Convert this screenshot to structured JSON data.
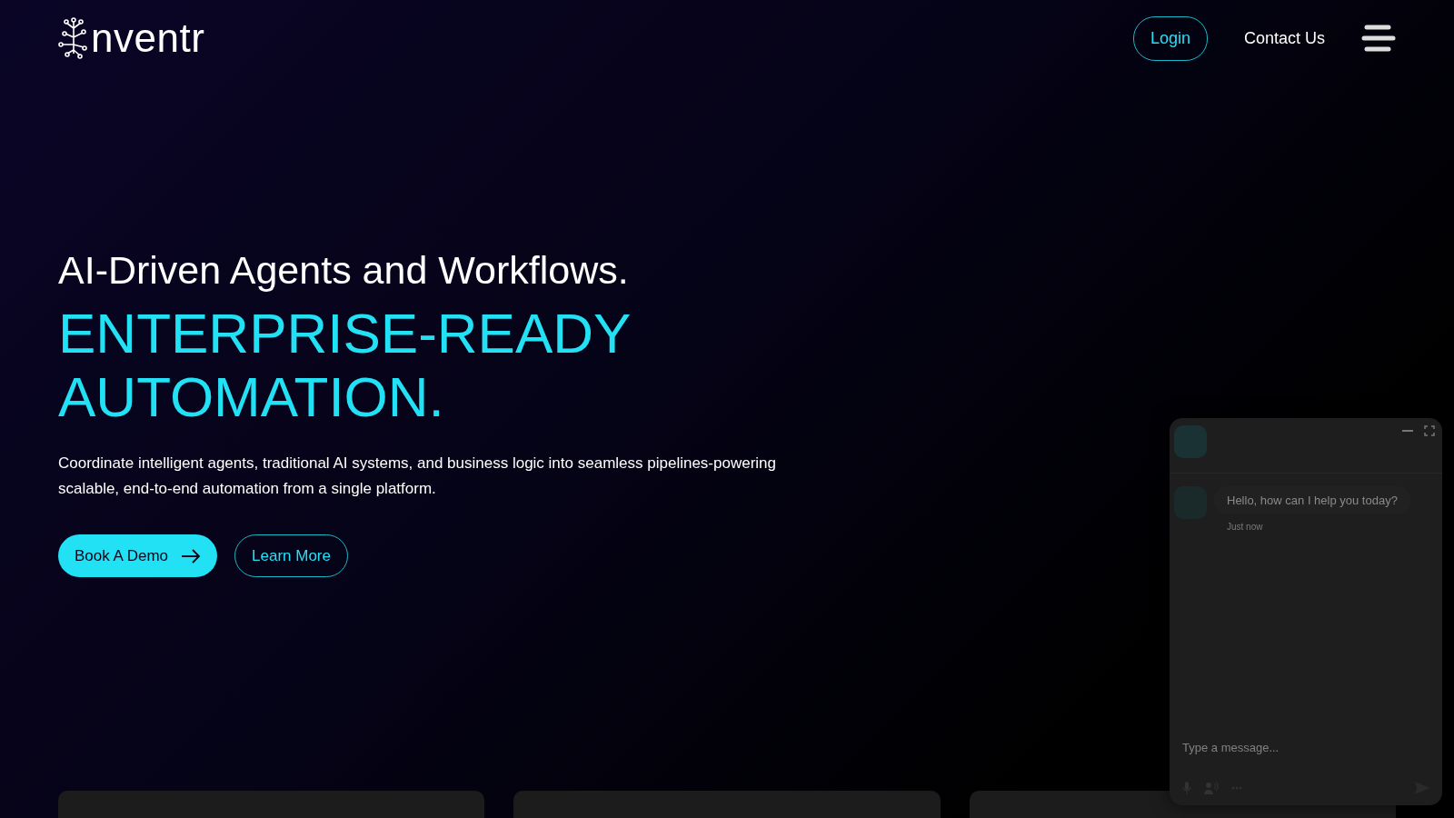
{
  "header": {
    "logo": "nventr",
    "nav": [
      {
        "kind": "outline",
        "label": "Login"
      },
      {
        "kind": "plain",
        "label": "Contact Us"
      }
    ]
  },
  "hero": {
    "subtitle": "AI-Driven Agents and Workflows.",
    "title_lines": [
      "ENTERPRISE-READY",
      "AUTOMATION."
    ],
    "description": "Coordinate intelligent agents, traditional AI systems, and business logic into seamless pipelines-powering scalable, end-to-end automation from a single platform.",
    "buttons": [
      {
        "kind": "primary",
        "label": "Book A Demo"
      },
      {
        "kind": "outline",
        "label": "Learn More"
      }
    ]
  },
  "chat": {
    "message": "Hello, how can I help you today?",
    "time": "Just now",
    "placeholder": "Type a message..."
  }
}
